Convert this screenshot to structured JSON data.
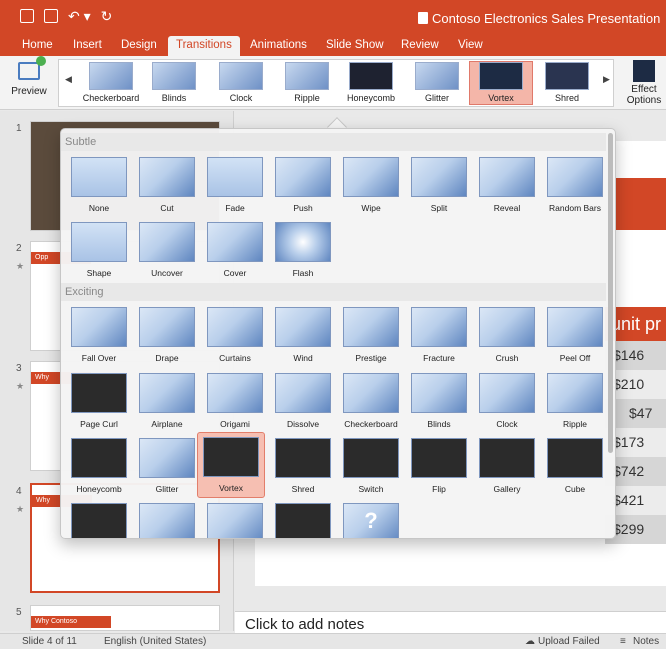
{
  "window": {
    "title": "Contoso Electronics Sales Presentation",
    "quick_access": [
      "sidebar-toggle-icon",
      "save-icon",
      "undo-icon",
      "redo-icon"
    ]
  },
  "tabs": [
    "Home",
    "Insert",
    "Design",
    "Transitions",
    "Animations",
    "Slide Show",
    "Review",
    "View"
  ],
  "active_tab": "Transitions",
  "ribbon": {
    "preview_label": "Preview",
    "gallery": [
      "Checkerboard",
      "Blinds",
      "Clock",
      "Ripple",
      "Honeycomb",
      "Glitter",
      "Vortex",
      "Shred"
    ],
    "selected": "Vortex",
    "effect_options_label": "Effect Options"
  },
  "thumbnails": {
    "numbers": [
      "1",
      "2",
      "3",
      "4",
      "5"
    ],
    "slide2_title": "Opp",
    "slide3_title": "Why",
    "slide4_title": "Why",
    "slide5_title": "Why Contoso"
  },
  "slide": {
    "column_header": "unit pr",
    "values": [
      "$146",
      "$210",
      "$47",
      "$173",
      "$742",
      "$421",
      "$299"
    ]
  },
  "notes_placeholder": "Click to add notes",
  "status": {
    "slide_position": "Slide 4 of 11",
    "language": "English (United States)",
    "upload": "Upload Failed",
    "notes": "Notes"
  },
  "popup": {
    "subtle_heading": "Subtle",
    "exciting_heading": "Exciting",
    "subtle": [
      "None",
      "Cut",
      "Fade",
      "Push",
      "Wipe",
      "Split",
      "Reveal",
      "Random Bars",
      "Shape",
      "Uncover",
      "Cover",
      "Flash"
    ],
    "exciting": [
      "Fall Over",
      "Drape",
      "Curtains",
      "Wind",
      "Prestige",
      "Fracture",
      "Crush",
      "Peel Off",
      "Page Curl",
      "Airplane",
      "Origami",
      "Dissolve",
      "Checkerboard",
      "Blinds",
      "Clock",
      "Ripple",
      "Honeycomb",
      "Glitter",
      "Vortex",
      "Shred",
      "Switch",
      "Flip",
      "Gallery",
      "Cube"
    ],
    "selected": "Vortex"
  }
}
